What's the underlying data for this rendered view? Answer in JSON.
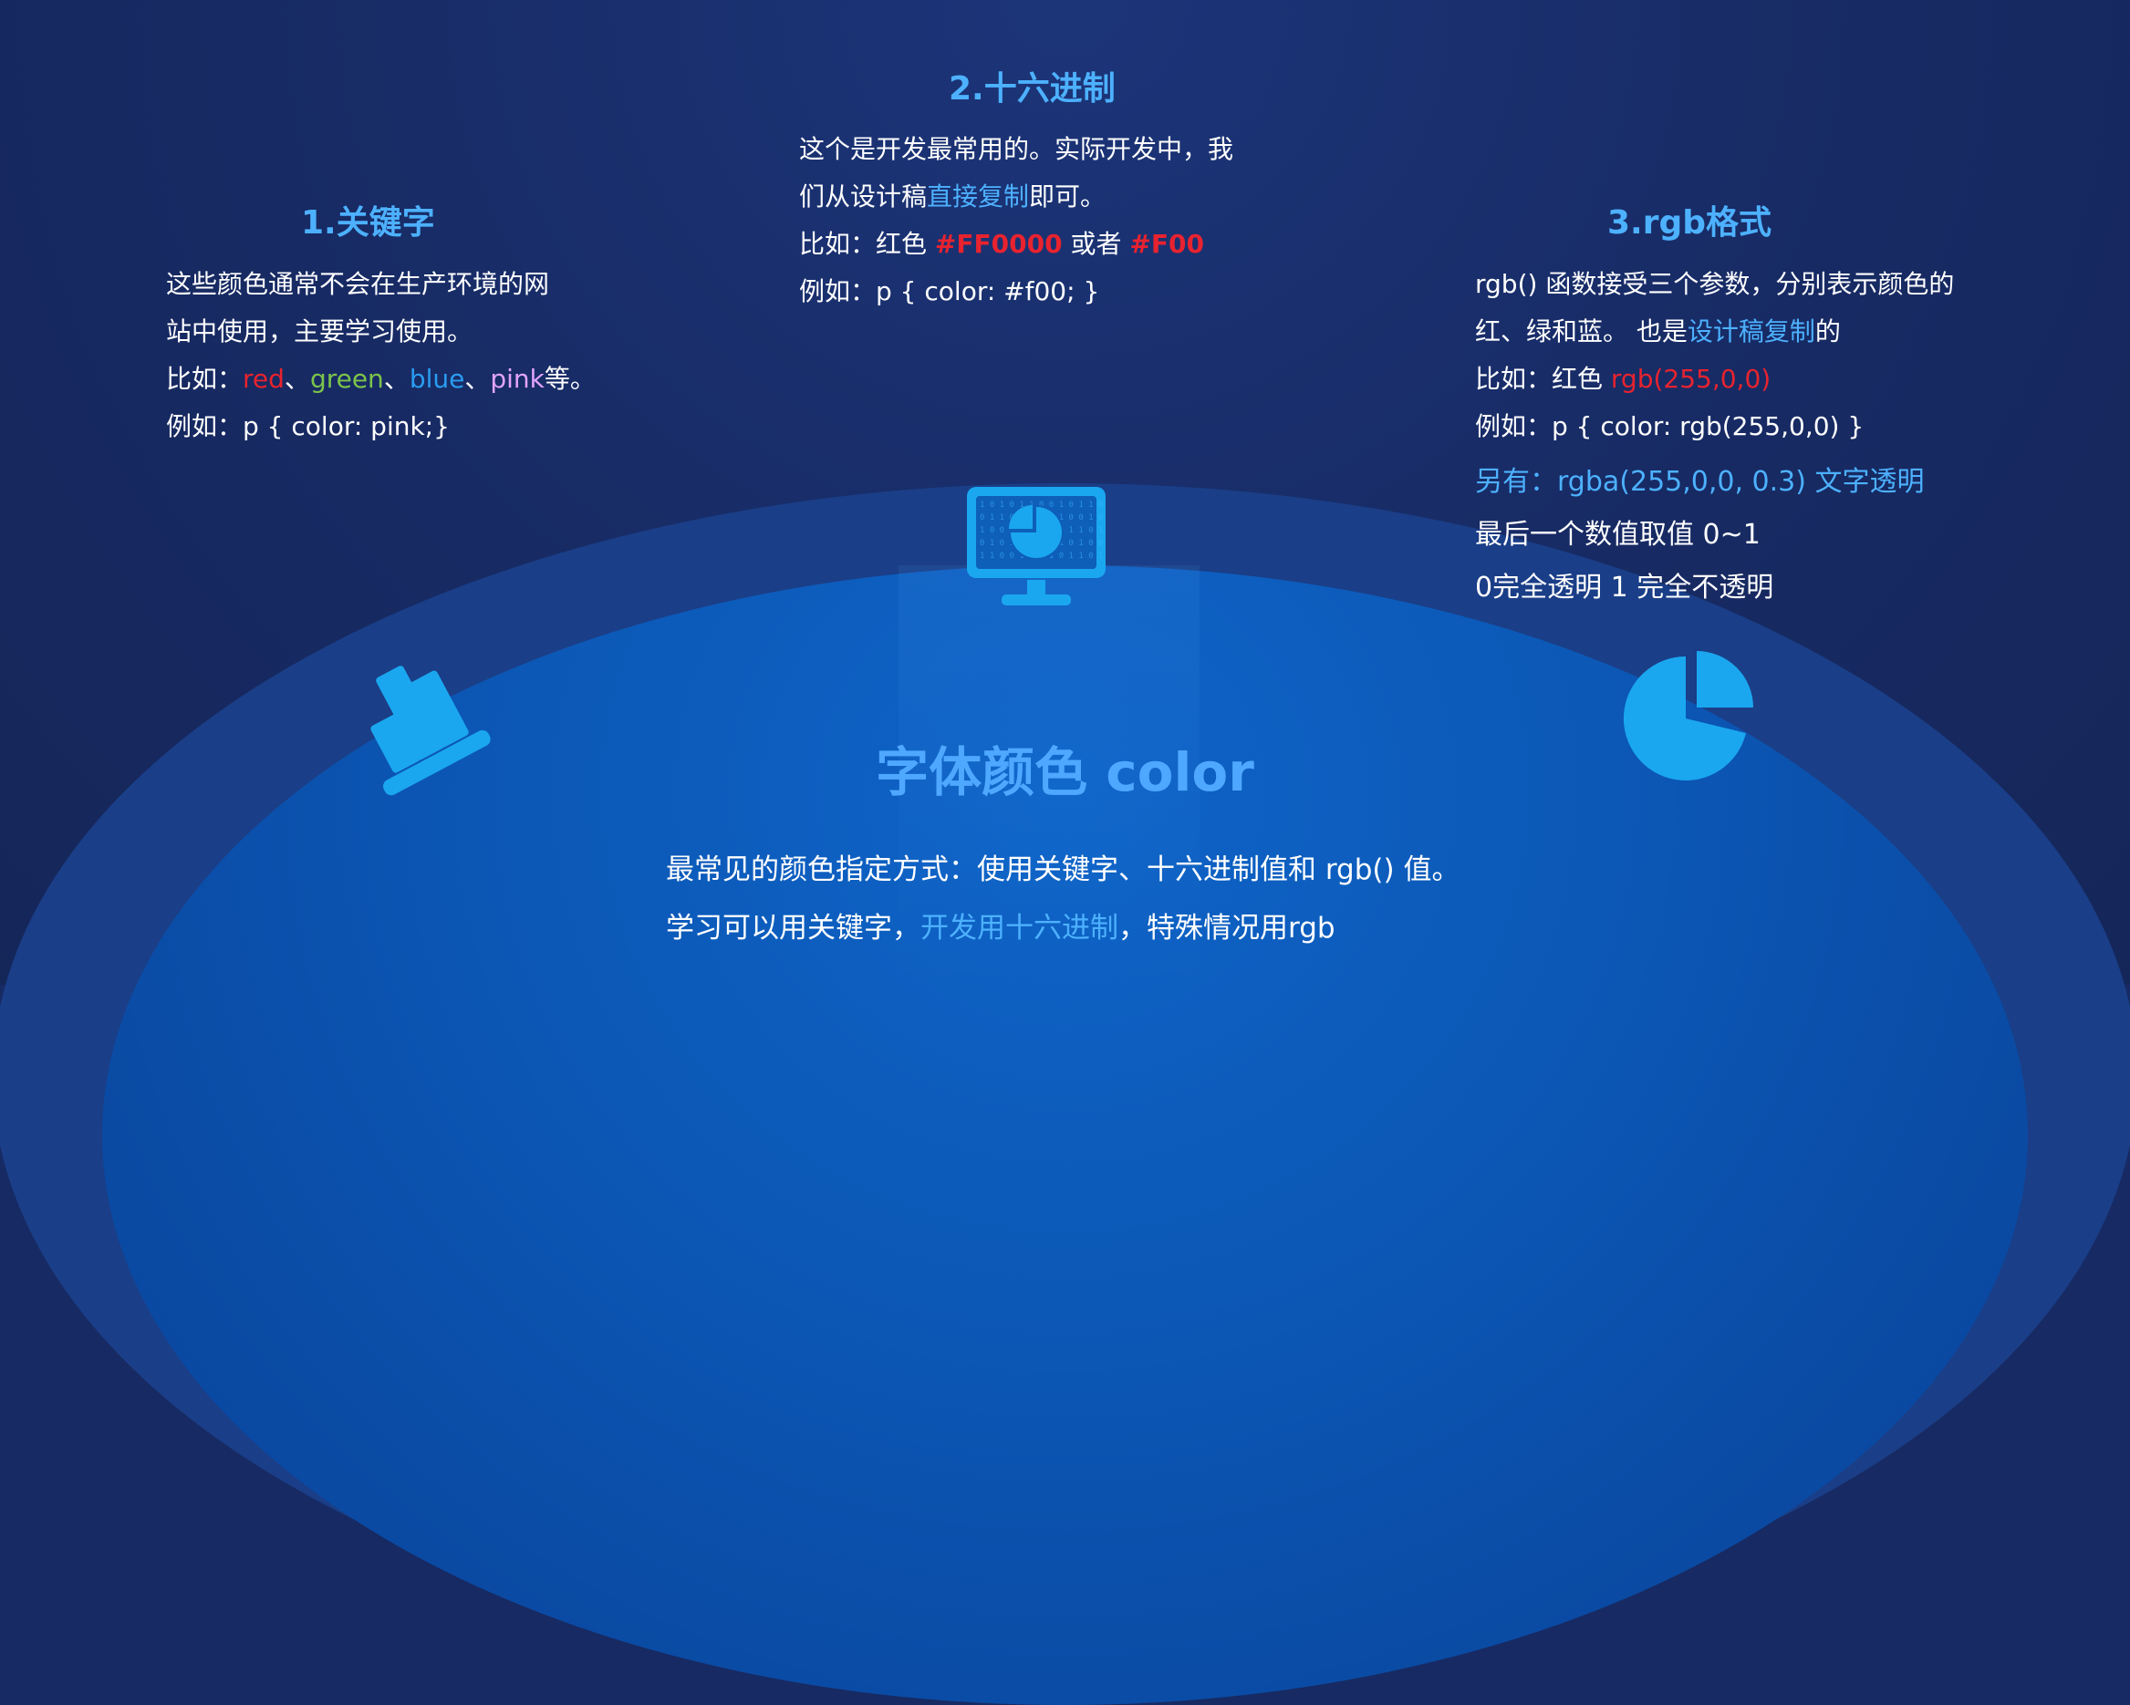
{
  "colors": {
    "background": "#172a63",
    "accent": "#4db1ff",
    "red": "#e8232f",
    "green": "#7cc44b",
    "blue": "#2a9cf0",
    "pink": "#e2a4ff",
    "icon": "#1aa7f0"
  },
  "section1": {
    "title": "1.关键字",
    "line1": "这些颜色通常不会在生产环境的网",
    "line2": "站中使用，主要学习使用。",
    "line3_prefix": "比如：",
    "kw_red": "red",
    "sep1": "、",
    "kw_green": "green",
    "sep2": "、",
    "kw_blue": "blue",
    "sep3": "、",
    "kw_pink": "pink",
    "line3_suffix": "等。",
    "line4": "例如：p { color: pink;}"
  },
  "section2": {
    "title": "2.十六进制",
    "line1": "这个是开发最常用的。实际开发中，我",
    "line2_prefix": "们从设计稿",
    "line2_highlight": "直接复制",
    "line2_suffix": "即可。",
    "line3_prefix": "比如：红色 ",
    "hex_long": "#FF0000",
    "line3_mid": " 或者 ",
    "hex_short": "#F00",
    "line4": "例如：p { color: #f00; }"
  },
  "section3": {
    "title": "3.rgb格式",
    "line1": "rgb() 函数接受三个参数，分别表示颜色的",
    "line2_prefix": "红、绿和蓝。 也是",
    "line2_highlight": "设计稿复制",
    "line2_suffix": "的",
    "line3_prefix": "比如：红色  ",
    "rgb_value": "rgb(255,0,0)",
    "line4": "例如：p { color: rgb(255,0,0) }",
    "line5": "另有：rgba(255,0,0, 0.3)  文字透明",
    "line6": "最后一个数值取值 0~1",
    "line7": "0完全透明   1 完全不透明"
  },
  "main": {
    "title": "字体颜色 color",
    "summary1": "最常见的颜色指定方式：使用关键字、十六进制值和 rgb() 值。",
    "summary2_prefix": "学习可以用关键字，",
    "summary2_highlight": "开发用十六进制",
    "summary2_suffix": "，特殊情况用rgb"
  },
  "icons": {
    "left": "bar-chart-icon",
    "center": "monitor-pie-chart-icon",
    "right": "pie-chart-icon"
  }
}
